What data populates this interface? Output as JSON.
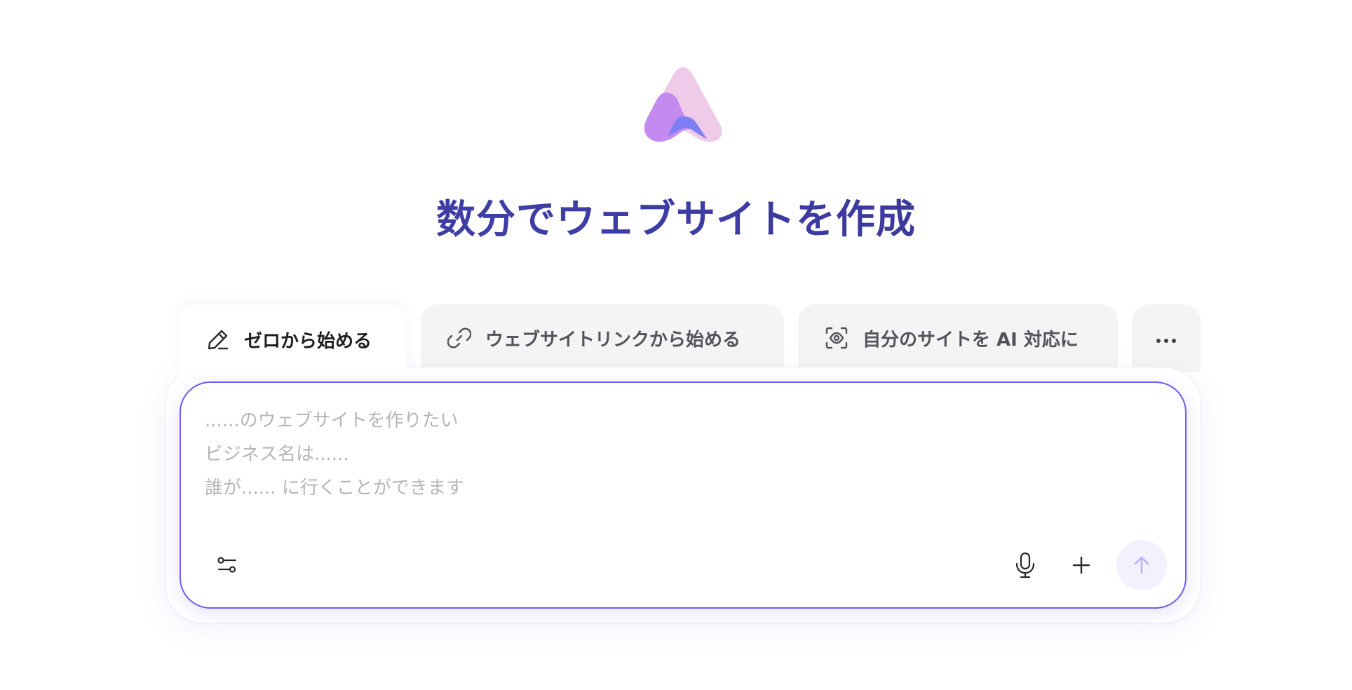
{
  "hero": {
    "headline": "数分でウェブサイトを作成"
  },
  "tabs": [
    {
      "label": "ゼロから始める",
      "icon": "pencil-icon",
      "active": true
    },
    {
      "label": "ウェブサイトリンクから始める",
      "icon": "link-icon",
      "active": false
    },
    {
      "label": "自分のサイトを AI 対応に",
      "icon": "eye-scan-icon",
      "active": false
    },
    {
      "label": "",
      "icon": "more-icon",
      "active": false
    }
  ],
  "composer": {
    "placeholder": "......のウェブサイトを作りたい\nビジネス名は......\n誰が...... に行くことができます",
    "value": "",
    "icons": {
      "settings": "sliders-icon",
      "mic": "microphone-icon",
      "add": "plus-icon",
      "send": "arrow-up-icon"
    }
  },
  "colors": {
    "accent": "#6d5df2",
    "headline": "#3a3a9a",
    "tab_inactive_bg": "#f4f4f5",
    "send_bg": "#f3f1fe",
    "send_icon": "#b9b0f7",
    "logo_pink": "#efcbe9",
    "logo_purple": "#c58af0",
    "logo_blue": "#7f7ef4"
  }
}
